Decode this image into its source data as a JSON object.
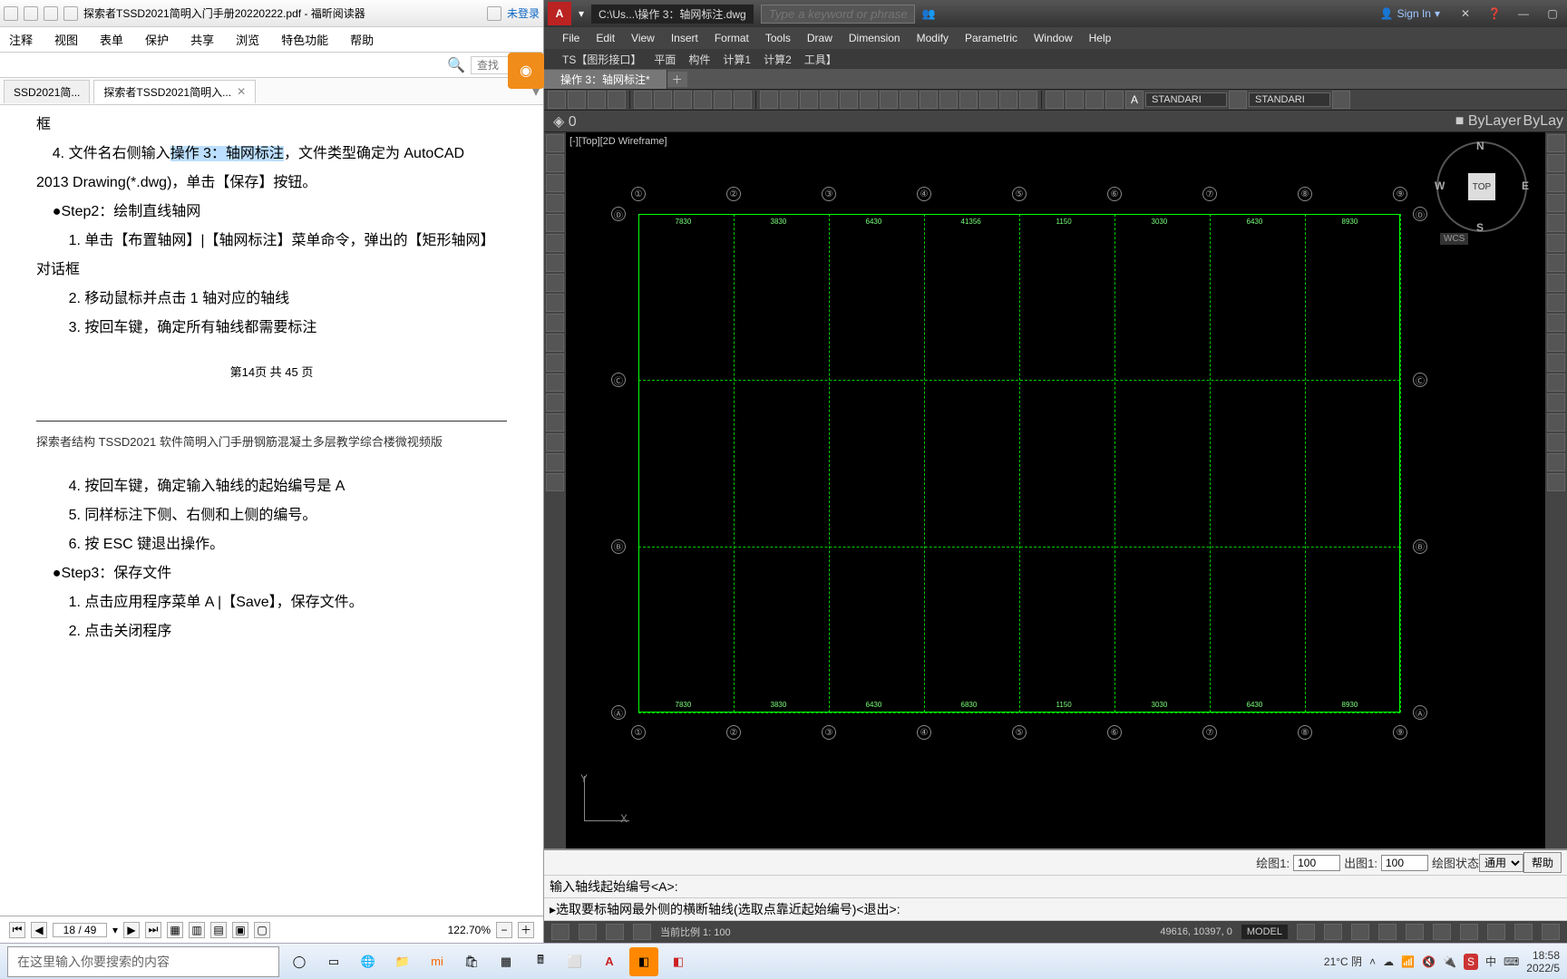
{
  "pdf": {
    "title_text": "探索者TSSD2021简明入门手册20220222.pdf - 福昕阅读器",
    "login_status": "未登录",
    "search_placeholder": "查找",
    "menu": [
      "注释",
      "视图",
      "表单",
      "保护",
      "共享",
      "浏览",
      "特色功能",
      "帮助"
    ],
    "tabs": [
      {
        "label": "SSD2021简..."
      },
      {
        "label": "探索者TSSD2021简明入..."
      }
    ],
    "body": {
      "l1_pre": "框",
      "l2a": "4. 文件名右侧输入",
      "l2hl": "操作 3：轴网标注",
      "l2b": "，文件类型确定为 AutoCAD",
      "l3": "2013 Drawing(*.dwg)，单击【保存】按钮。",
      "s2": "●Step2：绘制直线轴网",
      "s2_1": "1. 单击【布置轴网】|【轴网标注】菜单命令，弹出的【矩形轴网】",
      "s2_1b": "对话框",
      "s2_2": "2. 移动鼠标并点击 1 轴对应的轴线",
      "s2_3": "3. 按回车键，确定所有轴线都需要标注",
      "page_mid": "第14页 共 45 页",
      "hdr": "探索者结构 TSSD2021 软件简明入门手册钢筋混凝土多层教学综合楼微视频版",
      "b4": "4. 按回车键，确定输入轴线的起始编号是 A",
      "b5": "5. 同样标注下侧、右侧和上侧的编号。",
      "b6": "6. 按 ESC 键退出操作。",
      "s3": "●Step3：保存文件",
      "s3_1": "1. 点击应用程序菜单 A |【Save】，保存文件。",
      "s3_2": "2. 点击关闭程序"
    },
    "page_input": "18 / 49",
    "zoom": "122.70%"
  },
  "cad": {
    "app_logo": "A",
    "path": "C:\\Us...\\操作 3：轴网标注.dwg",
    "search_placeholder": "Type a keyword or phrase",
    "signin": "Sign In",
    "menu": [
      "File",
      "Edit",
      "View",
      "Insert",
      "Format",
      "Tools",
      "Draw",
      "Dimension",
      "Modify",
      "Parametric",
      "Window",
      "Help"
    ],
    "menu2": [
      "TS【图形接口】",
      "平面",
      "构件",
      "计算1",
      "计算2",
      "工具】"
    ],
    "tab": "操作 3：轴网标注*",
    "layer_sel": "0",
    "style1": "STANDARI",
    "style2": "STANDARI",
    "bylayer": "ByLayer",
    "bylay2": "ByLay",
    "view_label": "[-][Top][2D Wireframe]",
    "viewcube": {
      "top": "TOP",
      "n": "N",
      "s": "S",
      "e": "E",
      "w": "W",
      "wcs": "WCS"
    },
    "ucs": {
      "x": "X",
      "y": "Y"
    },
    "grid": {
      "cols": [
        "①",
        "②",
        "③",
        "④",
        "⑤",
        "⑥",
        "⑦",
        "⑧",
        "⑨"
      ],
      "rows": [
        "Ⓐ",
        "Ⓑ",
        "Ⓒ",
        "Ⓓ"
      ],
      "dims_top": [
        "7830",
        "3830",
        "6430",
        "41356",
        "1150",
        "3030",
        "6430",
        "8930"
      ],
      "dims_bot": [
        "7830",
        "3830",
        "6430",
        "6830",
        "1150",
        "3030",
        "6430",
        "8930"
      ]
    },
    "cmd1": "输入轴线起始编号<A>:",
    "cmd2": "选取要标轴网最外侧的横断轴线(选取点靠近起始编号)<退出>:",
    "opts": {
      "hui1": "绘图1:",
      "hui1v": "100",
      "chu1": "出图1:",
      "chu1v": "100",
      "state": "绘图状态",
      "statev": "通用",
      "help": "帮助"
    },
    "status": {
      "scale": "当前比例 1: 100",
      "coord": "49616, 10397, 0",
      "model": "MODEL"
    }
  },
  "taskbar": {
    "search_placeholder": "在这里输入你要搜索的内容",
    "weather": "21°C 阴",
    "ime": "中",
    "time": "18:58",
    "date": "2022/5"
  }
}
